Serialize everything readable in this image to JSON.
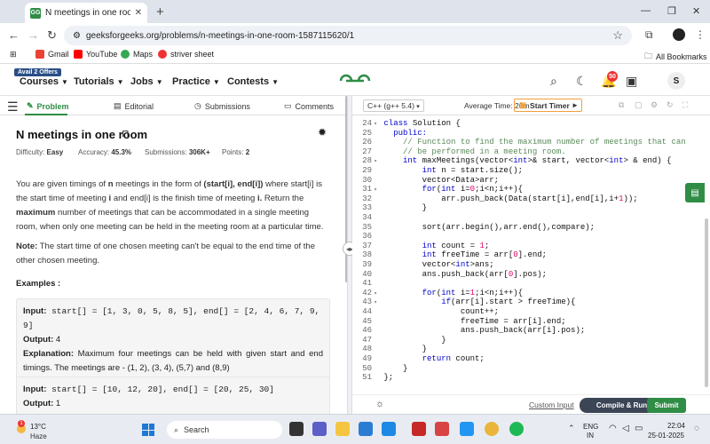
{
  "browser": {
    "tab_title": "N meetings in one room | Practice",
    "url": "geeksforgeeks.org/problems/n-meetings-in-one-room-1587115620/1",
    "bookmarks": [
      "Gmail",
      "YouTube",
      "Maps",
      "striver sheet"
    ],
    "all_bookmarks": "All Bookmarks"
  },
  "site": {
    "badge": "Avail 2 Offers",
    "nav": [
      "Courses",
      "Tutorials",
      "Jobs",
      "Practice",
      "Contests"
    ],
    "notif_count": "50",
    "user_initial": "S"
  },
  "panel": {
    "tabs": [
      "Problem",
      "Editorial",
      "Submissions",
      "Comments"
    ],
    "title": "N meetings in one room",
    "difficulty_label": "Difficulty:",
    "difficulty": "Easy",
    "accuracy_label": "Accuracy:",
    "accuracy": "45.3%",
    "submissions_label": "Submissions:",
    "submissions": "306K+",
    "points_label": "Points:",
    "points": "2",
    "desc": {
      "p1": "You are given timings of ",
      "n": "n",
      "p2": " meetings in the form of ",
      "se": "(start[i], end[i])",
      "p3": " where start[i] is the start time of meeting ",
      "i1": "i",
      "p4": " and end[i] is the finish time of meeting ",
      "i2": "i.",
      "p5": " Return the ",
      "max": "maximum",
      "p6": " number of meetings that can be accommodated in a single meeting room, when only one meeting can be held in the meeting room at a particular time."
    },
    "note_label": "Note:",
    "note": " The start time of one chosen meeting can't be equal to the end time of the other chosen meeting.",
    "examples_label": "Examples :",
    "example1": {
      "input_label": "Input:",
      "input": " start[] = [1, 3, 0, 5, 8, 5], end[] =  [2, 4, 6, 7, 9, 9]",
      "output_label": "Output:",
      "output": " 4",
      "expl_label": "Explanation:",
      "expl": " Maximum four meetings can be held with given start and end timings. The meetings are - (1, 2), (3, 4), (5,7) and (8,9)"
    },
    "example2": {
      "input_label": "Input:",
      "input": " start[] = [10, 12, 20], end[] = [20, 25, 30]",
      "output_label": "Output:",
      "output": " 1"
    }
  },
  "editor": {
    "language": "C++ (g++ 5.4)",
    "avg_time": "Average Time: 20m",
    "timer": "Start Timer",
    "first_line": 24,
    "lines": [
      {
        "fold": "▾",
        "code": [
          [
            "kw",
            "class "
          ],
          [
            "ct",
            "Solution {"
          ]
        ]
      },
      {
        "fold": "",
        "code": [
          [
            "kw",
            "  public:"
          ]
        ]
      },
      {
        "fold": "",
        "code": [
          [
            "cm",
            "    // Function to find the maximum number of meetings that can"
          ]
        ]
      },
      {
        "fold": "",
        "code": [
          [
            "cm",
            "    // be performed in a meeting room."
          ]
        ]
      },
      {
        "fold": "▾",
        "code": [
          [
            "kw",
            "    int "
          ],
          [
            "ct",
            "maxMeetings(vector<"
          ],
          [
            "kw",
            "int"
          ],
          [
            "ct",
            ">& start, vector<"
          ],
          [
            "kw",
            "int"
          ],
          [
            "ct",
            "> & end) {"
          ]
        ]
      },
      {
        "fold": "",
        "code": [
          [
            "kw",
            "        int "
          ],
          [
            "ct",
            "n = start.size();"
          ]
        ]
      },
      {
        "fold": "",
        "code": [
          [
            "ct",
            "        vector<Data>arr;"
          ]
        ]
      },
      {
        "fold": "▾",
        "code": [
          [
            "kw",
            "        for"
          ],
          [
            "ct",
            "("
          ],
          [
            "kw",
            "int "
          ],
          [
            "ct",
            "i="
          ],
          [
            "num",
            "0"
          ],
          [
            "ct",
            ";i<n;i++){"
          ]
        ]
      },
      {
        "fold": "",
        "code": [
          [
            "ct",
            "            arr.push_back(Data(start[i],end[i],i+"
          ],
          [
            "num",
            "1"
          ],
          [
            "ct",
            "));"
          ]
        ]
      },
      {
        "fold": "",
        "code": [
          [
            "ct",
            "        }"
          ]
        ]
      },
      {
        "fold": "",
        "code": [
          [
            "ct",
            ""
          ]
        ]
      },
      {
        "fold": "",
        "code": [
          [
            "ct",
            "        sort(arr.begin(),arr.end(),compare);"
          ]
        ]
      },
      {
        "fold": "",
        "code": [
          [
            "ct",
            ""
          ]
        ]
      },
      {
        "fold": "",
        "code": [
          [
            "kw",
            "        int "
          ],
          [
            "ct",
            "count = "
          ],
          [
            "num",
            "1"
          ],
          [
            "ct",
            ";"
          ]
        ]
      },
      {
        "fold": "",
        "code": [
          [
            "kw",
            "        int "
          ],
          [
            "ct",
            "freeTime = arr["
          ],
          [
            "num",
            "0"
          ],
          [
            "ct",
            "].end;"
          ]
        ]
      },
      {
        "fold": "",
        "code": [
          [
            "ct",
            "        vector<"
          ],
          [
            "kw",
            "int"
          ],
          [
            "ct",
            ">ans;"
          ]
        ]
      },
      {
        "fold": "",
        "code": [
          [
            "ct",
            "        ans.push_back(arr["
          ],
          [
            "num",
            "0"
          ],
          [
            "ct",
            "].pos);"
          ]
        ]
      },
      {
        "fold": "",
        "code": [
          [
            "ct",
            ""
          ]
        ]
      },
      {
        "fold": "▾",
        "code": [
          [
            "kw",
            "        for"
          ],
          [
            "ct",
            "("
          ],
          [
            "kw",
            "int "
          ],
          [
            "ct",
            "i="
          ],
          [
            "num",
            "1"
          ],
          [
            "ct",
            ";i<n;i++){"
          ]
        ]
      },
      {
        "fold": "▾",
        "code": [
          [
            "kw",
            "            if"
          ],
          [
            "ct",
            "(arr[i].start > freeTime){"
          ]
        ]
      },
      {
        "fold": "",
        "code": [
          [
            "ct",
            "                count++;"
          ]
        ]
      },
      {
        "fold": "",
        "code": [
          [
            "ct",
            "                freeTime = arr[i].end;"
          ]
        ]
      },
      {
        "fold": "",
        "code": [
          [
            "ct",
            "                ans.push_back(arr[i].pos);"
          ]
        ]
      },
      {
        "fold": "",
        "code": [
          [
            "ct",
            "            }"
          ]
        ]
      },
      {
        "fold": "",
        "code": [
          [
            "ct",
            "        }"
          ]
        ]
      },
      {
        "fold": "",
        "code": [
          [
            "kw",
            "        return "
          ],
          [
            "ct",
            "count;"
          ]
        ]
      },
      {
        "fold": "",
        "code": [
          [
            "ct",
            "    }"
          ]
        ]
      },
      {
        "fold": "",
        "code": [
          [
            "ct",
            "};"
          ]
        ]
      }
    ],
    "custom_input": "Custom Input",
    "run": "Compile & Run",
    "submit": "Submit"
  },
  "taskbar": {
    "weather_badge": "1",
    "temp": "13°C",
    "weather": "Haze",
    "search": "Search",
    "lang1": "ENG",
    "lang2": "IN",
    "time": "22:04",
    "date": "25-01-2025"
  }
}
